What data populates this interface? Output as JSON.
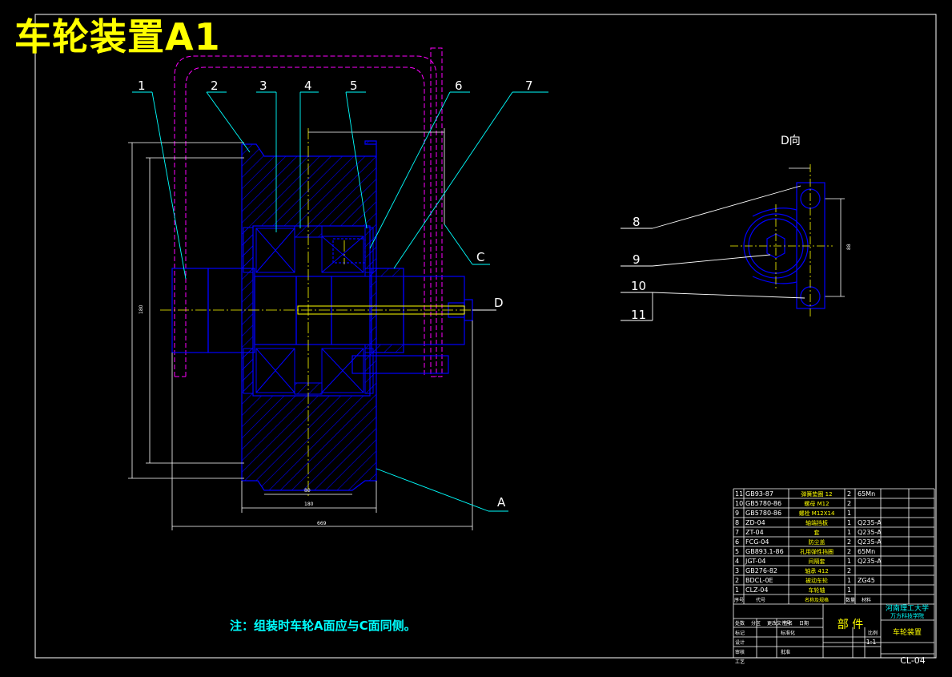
{
  "title": "车轮装置A1",
  "callouts": [
    "1",
    "2",
    "3",
    "4",
    "5",
    "6",
    "7"
  ],
  "view_labels": {
    "C": "C",
    "D": "D",
    "A": "A"
  },
  "view_d": {
    "title": "D向",
    "callouts": [
      "8",
      "9",
      "10",
      "11"
    ]
  },
  "note": "注：组装时车轮A面应与C面同侧。",
  "bom": [
    {
      "no": "11",
      "code": "GB93-87",
      "name": "弹簧垫圈 12",
      "qty": "2",
      "material": "65Mn"
    },
    {
      "no": "10",
      "code": "GB5780-86",
      "name": "螺母 M12",
      "qty": "2",
      "material": ""
    },
    {
      "no": "9",
      "code": "GB5780-86",
      "name": "螺栓 M12X14",
      "qty": "1",
      "material": ""
    },
    {
      "no": "8",
      "code": "ZD-04",
      "name": "轴端挡板",
      "qty": "1",
      "material": "Q235-A"
    },
    {
      "no": "7",
      "code": "ZT-04",
      "name": "套",
      "qty": "1",
      "material": "Q235-A"
    },
    {
      "no": "6",
      "code": "FCG-04",
      "name": "防尘盖",
      "qty": "2",
      "material": "Q235-A"
    },
    {
      "no": "5",
      "code": "GB893.1-86",
      "name": "孔用弹性挡圈",
      "qty": "2",
      "material": "65Mn"
    },
    {
      "no": "4",
      "code": "JGT-04",
      "name": "间隔套",
      "qty": "1",
      "material": "Q235-A"
    },
    {
      "no": "3",
      "code": "GB276-82",
      "name": "轴承 412",
      "qty": "2",
      "material": ""
    },
    {
      "no": "2",
      "code": "BDCL-0E",
      "name": "被动车轮",
      "qty": "1",
      "material": "ZG45"
    },
    {
      "no": "1",
      "code": "CLZ-04",
      "name": "车轮轴",
      "qty": "1",
      "material": ""
    }
  ],
  "title_block": {
    "school": "河南理工大学",
    "college": "万方科技学院",
    "part_label": "部 件",
    "drawing_name": "车轮装置",
    "drawing_no": "CL-04",
    "scale": "1:1",
    "header_no": "序号",
    "header_code": "代号",
    "header_name": "名称及规格",
    "header_qty": "数量",
    "header_material": "材料",
    "sign_rows": [
      "标记",
      "设计",
      "审核",
      "工艺"
    ],
    "sign_cols": [
      "处数",
      "分区",
      "更改文件号",
      "签名",
      "日期"
    ],
    "sign_sub": [
      "标准化",
      "批准"
    ],
    "scale_header": "比例"
  },
  "dims": {
    "d1": "180",
    "d2": "80",
    "d3": "180",
    "d4": "669",
    "side": "88"
  },
  "colors": {
    "outline": "#0000ff",
    "hatch": "#0000ff",
    "center": "#ffff00",
    "leader": "#00ffff",
    "frame_pink": "#ff00ff",
    "white": "#ffffff",
    "text_cyan": "#00ffff"
  }
}
